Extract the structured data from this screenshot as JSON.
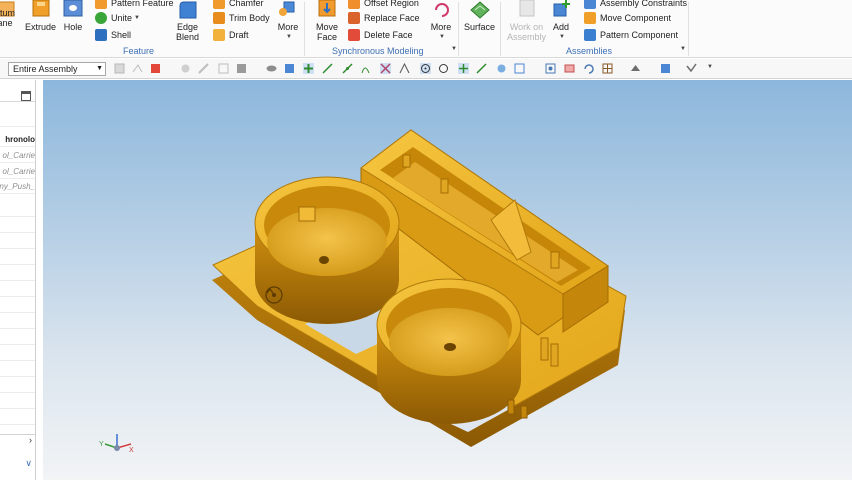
{
  "ribbon": {
    "feature_group": {
      "label": "Feature",
      "datum_label": "atum\nane",
      "extrude_label": "Extrude",
      "hole_label": "Hole",
      "pattern_label": "Pattern Feature",
      "unite_label": "Unite",
      "shell_label": "Shell",
      "edge_blend_label": "Edge\nBlend",
      "chamfer_label": "Chamfer",
      "trim_body_label": "Trim Body",
      "draft_label": "Draft",
      "more_label": "More"
    },
    "sync_group": {
      "label": "Synchronous Modeling",
      "move_face_label": "Move\nFace",
      "offset_region_label": "Offset Region",
      "replace_face_label": "Replace Face",
      "delete_face_label": "Delete Face",
      "more_label": "More"
    },
    "surface_label": "Surface",
    "assemblies_group": {
      "label": "Assemblies",
      "work_on_assembly_label": "Work on\nAssembly",
      "add_label": "Add",
      "assembly_constraints_label": "Assembly Constraints",
      "move_component_label": "Move Component",
      "pattern_component_label": "Pattern Component"
    }
  },
  "selection_bar": {
    "filter_value": "Entire Assembly"
  },
  "navigator": {
    "column_title": "hronolo",
    "items": [
      "ol_Carrie",
      "ol_Carrie",
      "ny_Push_"
    ]
  },
  "colors": {
    "part_light": "#f0b92f",
    "part_mid": "#d99a14",
    "part_dark": "#a56d05",
    "accent_blue": "#3d6fb4"
  }
}
